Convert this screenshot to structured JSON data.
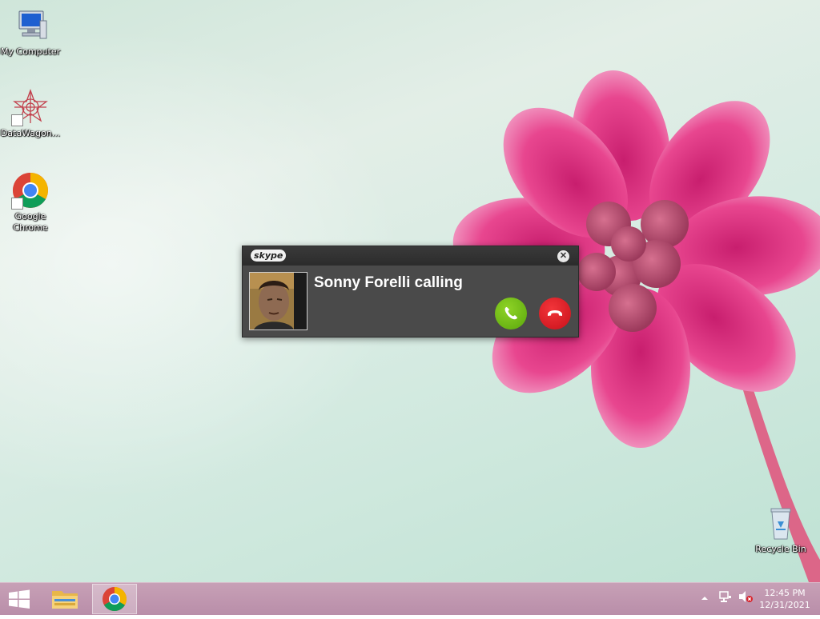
{
  "desktop": {
    "icons": [
      {
        "label": "My Computer",
        "icon": "computer-icon"
      },
      {
        "label": "DataWagon...",
        "icon": "datawagon-icon"
      },
      {
        "label": "Google Chrome",
        "icon": "chrome-icon"
      },
      {
        "label": "Recycle Bin",
        "icon": "recycle-bin-icon"
      }
    ]
  },
  "skype_popup": {
    "logo_text": "skype",
    "close_icon": "close-icon",
    "caller_text": "Sonny Forelli calling",
    "answer_icon": "phone-answer-icon",
    "decline_icon": "phone-hangup-icon",
    "answer_color": "#6dbb13",
    "decline_color": "#e0141c"
  },
  "taskbar": {
    "start_icon": "windows-logo-icon",
    "pinned": [
      {
        "name": "File Explorer",
        "icon": "folder-icon"
      },
      {
        "name": "Google Chrome",
        "icon": "chrome-icon",
        "active": true
      }
    ],
    "tray": {
      "show_hidden_icon": "chevron-up-icon",
      "network_icon": "network-icon",
      "volume_icon": "volume-muted-icon"
    },
    "clock": {
      "time": "12:45 PM",
      "date": "12/31/2021"
    }
  }
}
